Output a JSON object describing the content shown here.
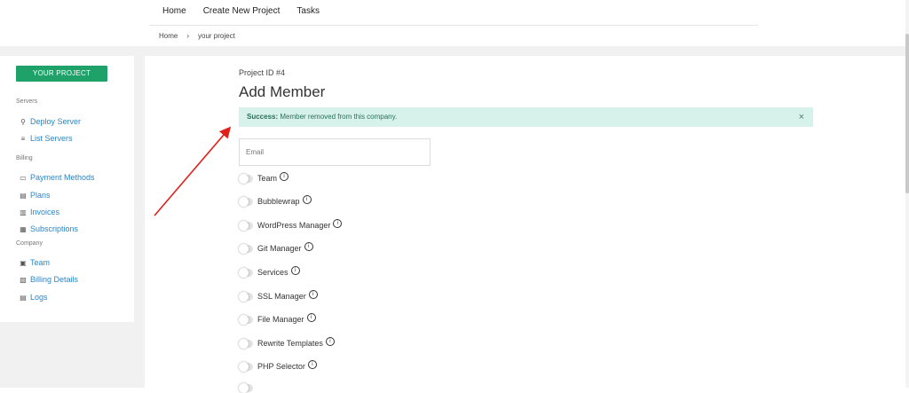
{
  "nav": {
    "links": [
      "Home",
      "Create New Project",
      "Tasks"
    ]
  },
  "breadcrumb": {
    "home": "Home",
    "sep": "›",
    "current": "your project"
  },
  "sidebar": {
    "project_button": "YOUR PROJECT",
    "sections": {
      "servers": "Servers",
      "billing": "Billing",
      "company": "Company"
    },
    "items": [
      {
        "label": "Deploy Server",
        "icon": "rocket-icon",
        "glyph": "⚲"
      },
      {
        "label": "List Servers",
        "icon": "list-icon",
        "glyph": "≡"
      },
      {
        "label": "Payment Methods",
        "icon": "card-icon",
        "glyph": "▭"
      },
      {
        "label": "Plans",
        "icon": "plans-icon",
        "glyph": "▤"
      },
      {
        "label": "Invoices",
        "icon": "invoice-icon",
        "glyph": "▥"
      },
      {
        "label": "Subscriptions",
        "icon": "subscriptions-icon",
        "glyph": "▦"
      },
      {
        "label": "Team",
        "icon": "team-icon",
        "glyph": "▣"
      },
      {
        "label": "Billing Details",
        "icon": "id-card-icon",
        "glyph": "▧"
      },
      {
        "label": "Logs",
        "icon": "logs-icon",
        "glyph": "▤"
      }
    ]
  },
  "main": {
    "project_id": "Project ID #4",
    "title": "Add Member",
    "alert": {
      "strong": "Success:",
      "message": " Member removed from this company.",
      "close": "×"
    },
    "email_placeholder": "Email",
    "permissions": [
      "Team",
      "Bubblewrap",
      "WordPress Manager",
      "Git Manager",
      "Services",
      "SSL Manager",
      "File Manager",
      "Rewrite Templates",
      "PHP Selector",
      ""
    ],
    "info_glyph": "i"
  },
  "colors": {
    "accent": "#1fa16a",
    "link": "#2a86c5",
    "alert_bg": "#d6f2ea",
    "arrow": "#e0201b"
  }
}
